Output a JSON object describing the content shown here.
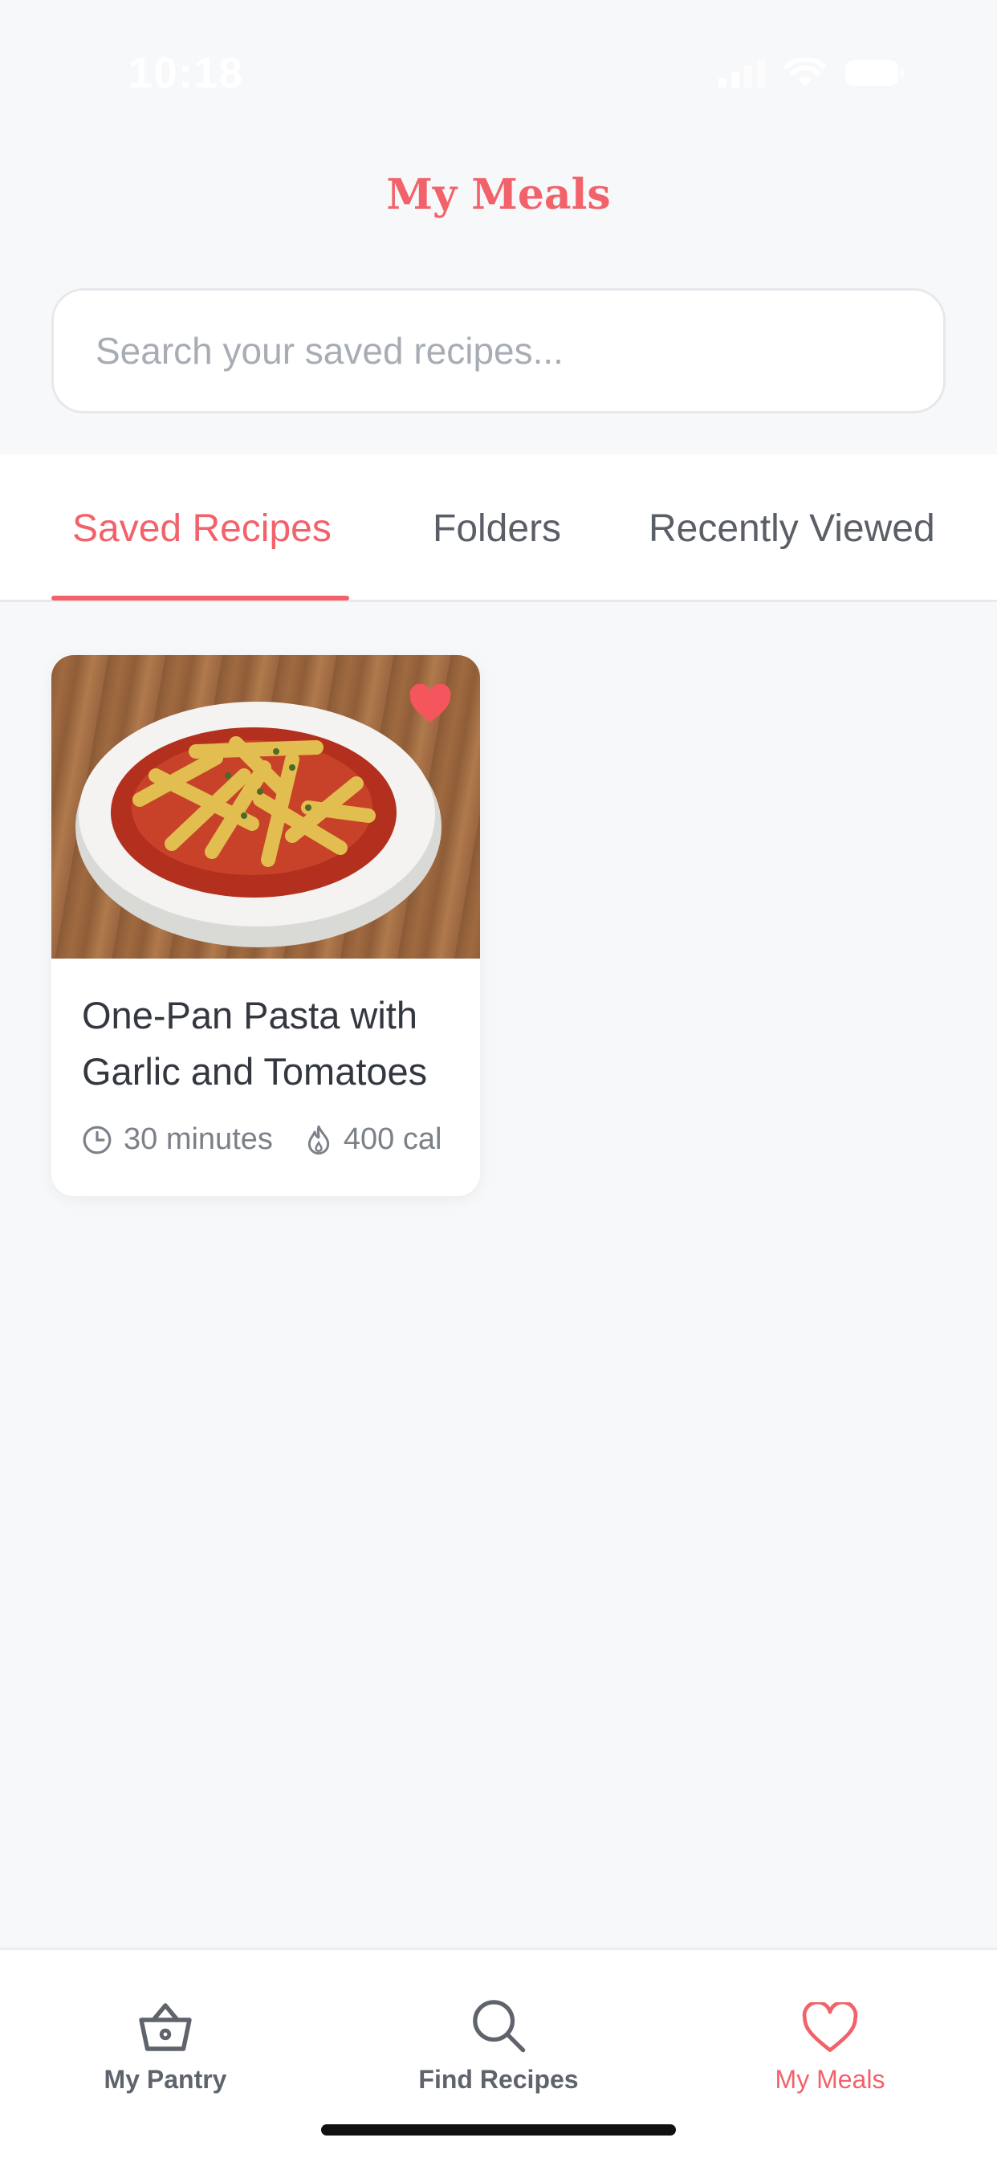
{
  "status_bar": {
    "time": "10:18"
  },
  "header": {
    "title": "My Meals"
  },
  "search": {
    "placeholder": "Search your saved recipes..."
  },
  "tabs": [
    {
      "label": "Saved Recipes",
      "active": true
    },
    {
      "label": "Folders",
      "active": false
    },
    {
      "label": "Recently Viewed",
      "active": false
    }
  ],
  "recipes": [
    {
      "title_line1": "One-Pan Pasta with",
      "title_line2": "Garlic and Tomatoes",
      "time": "30 minutes",
      "calories": "400 cal",
      "favorited": true
    }
  ],
  "bottom_nav": [
    {
      "label": "My Pantry",
      "icon": "basket-icon",
      "active": false
    },
    {
      "label": "Find Recipes",
      "icon": "search-icon",
      "active": false
    },
    {
      "label": "My Meals",
      "icon": "heart-icon",
      "active": true
    }
  ],
  "colors": {
    "accent": "#f2626a",
    "background": "#f7f8fa",
    "text": "#333740",
    "muted": "#7b8089"
  }
}
